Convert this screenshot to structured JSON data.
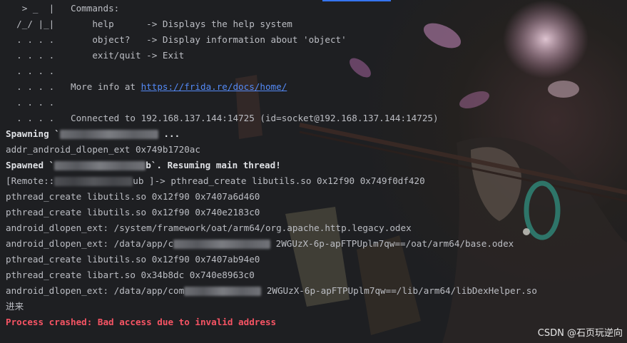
{
  "banner": {
    "art_1": "   > _  |",
    "art_2": "  /_/ |_|",
    "art_dots": "  . . . .",
    "commands_label": "Commands:",
    "cmd_help": "help      -> Displays the help system",
    "cmd_object": "object?   -> Display information about 'object'",
    "cmd_exit": "exit/quit -> Exit",
    "more_info": "More info at ",
    "docs_url": "https://frida.re/docs/home/",
    "connected": "Connected to 192.168.137.144:14725 (id=socket@192.168.137.144:14725)"
  },
  "output": {
    "spawning_prefix": "Spawning `",
    "spawning_suffix": "...",
    "addr_line": "addr_android_dlopen_ext 0x749b1720ac",
    "spawned_prefix": "Spawned `",
    "spawned_suffix": "b`. Resuming main thread!",
    "prompt_prefix": "[Remote::",
    "prompt_suffix": "ub ]-> pthread_create libutils.so 0x12f90 0x749f0df420",
    "line_pc1": "pthread_create libutils.so 0x12f90 0x7407a6d460",
    "line_pc2": "pthread_create libutils.so 0x12f90 0x740e2183c0",
    "line_dl1": "android_dlopen_ext: /system/framework/oat/arm64/org.apache.http.legacy.odex",
    "line_dl2_prefix": "android_dlopen_ext: /data/app/c",
    "line_dl2_suffix": "2WGUzX-6p-apFTPUplm7qw==/oat/arm64/base.odex",
    "line_pc3": "pthread_create libutils.so 0x12f90 0x7407ab94e0",
    "line_pc4": "pthread_create libart.so 0x34b8dc 0x740e8963c0",
    "line_dl3_prefix": "android_dlopen_ext: /data/app/com",
    "line_dl3_suffix": "2WGUzX-6p-apFTPUplm7qw==/lib/arm64/libDexHelper.so",
    "line_cn": "进来",
    "crash": "Process crashed: Bad access due to invalid address"
  },
  "watermark": "CSDN @石页玩逆向",
  "colors": {
    "background": "#1e1f22",
    "text": "#bcbec4",
    "link": "#548af7",
    "error": "#f75464"
  }
}
